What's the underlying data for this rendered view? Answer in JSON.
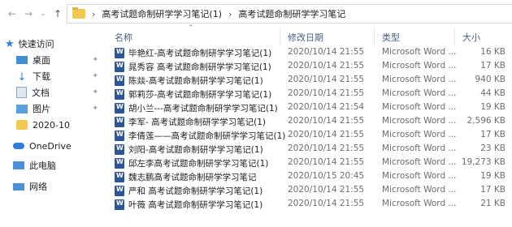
{
  "breadcrumb": [
    "高考试题命制研学学习笔记(1)",
    "高考试题命制研学学习笔记"
  ],
  "sidebar": {
    "quick_access": "快速访问",
    "items": [
      {
        "label": "桌面",
        "icon": "desktop-icon",
        "pinned": true
      },
      {
        "label": "下载",
        "icon": "download-icon",
        "pinned": true
      },
      {
        "label": "文档",
        "icon": "documents-icon",
        "pinned": true
      },
      {
        "label": "图片",
        "icon": "pictures-icon",
        "pinned": true
      },
      {
        "label": "2020-10",
        "icon": "folder-icon",
        "pinned": false
      }
    ],
    "onedrive": "OneDrive",
    "this_pc": "此电脑",
    "network": "网络"
  },
  "columns": {
    "name": "名称",
    "date": "修改日期",
    "type": "类型",
    "size": "大小"
  },
  "files": [
    {
      "name": "毕艳红-高考试题命制研学学习笔记(1)",
      "date": "2020/10/14 21:55",
      "type": "Microsoft Word ...",
      "size": "16 KB"
    },
    {
      "name": "晁秀容 高考试题命制研学学习笔记(1)",
      "date": "2020/10/14 21:55",
      "type": "Microsoft Word ...",
      "size": "17 KB"
    },
    {
      "name": "陈燚-高考试题命制研学学习笔记(1)",
      "date": "2020/10/14 21:55",
      "type": "Microsoft Word ...",
      "size": "940 KB"
    },
    {
      "name": "郭莉莎-高考试题命制研学学习笔记(1)",
      "date": "2020/10/14 21:55",
      "type": "Microsoft Word ...",
      "size": "44 KB"
    },
    {
      "name": "胡小兰---高考试题命制研学学习笔记(1)",
      "date": "2020/10/14 21:54",
      "type": "Microsoft Word ...",
      "size": "19 KB"
    },
    {
      "name": "李军- 高考试题命制研学学习笔记(1)",
      "date": "2020/10/14 21:55",
      "type": "Microsoft Word ...",
      "size": "2,596 KB"
    },
    {
      "name": "李倩莲——高考试题命制研学学习笔记(1)",
      "date": "2020/10/14 21:55",
      "type": "Microsoft Word ...",
      "size": "17 KB"
    },
    {
      "name": "刘阳-高考试题命制研学学习笔记(1)",
      "date": "2020/10/14 21:55",
      "type": "Microsoft Word ...",
      "size": "23 KB"
    },
    {
      "name": "邱左李高考试题命制研学学习笔记(1)",
      "date": "2020/10/14 21:55",
      "type": "Microsoft Word ...",
      "size": "19,273 KB"
    },
    {
      "name": "魏志鹏高考试题命制研学学习笔记",
      "date": "2020/10/15 20:45",
      "type": "Microsoft Word ...",
      "size": "19 KB"
    },
    {
      "name": "严和 高考试题命制研学学习笔记(1)",
      "date": "2020/10/14 21:55",
      "type": "Microsoft Word ...",
      "size": "17 KB"
    },
    {
      "name": "叶薇 高考试题命制研学学习笔记(1)",
      "date": "2020/10/14 21:55",
      "type": "Microsoft Word ...",
      "size": "21 KB"
    }
  ]
}
